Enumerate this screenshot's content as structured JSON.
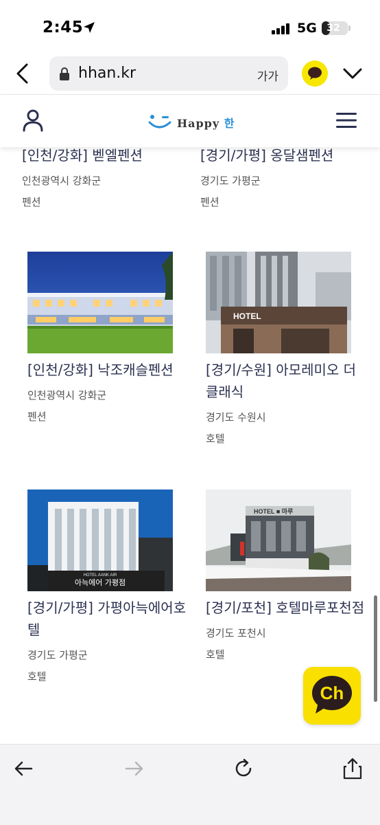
{
  "status_bar": {
    "time": "2:45",
    "network": "5G",
    "battery": "32",
    "battery_level": 0.32
  },
  "browser": {
    "url": "hhan.kr",
    "text_size_label": "가가"
  },
  "site": {
    "logo_text": "Happy",
    "logo_han": "한"
  },
  "listings": [
    {
      "title": "[인천/강화] 벧엘펜션",
      "address": "인천광역시 강화군",
      "type": "펜션"
    },
    {
      "title": "[경기/가평] 옹달샘펜션",
      "address": "경기도 가평군",
      "type": "펜션"
    },
    {
      "title": "[인천/강화] 낙조캐슬펜션",
      "address": "인천광역시 강화군",
      "type": "펜션"
    },
    {
      "title": "[경기/수원] 아모레미오 더 클래식",
      "address": "경기도 수원시",
      "type": "호텔",
      "sign": "HOTEL"
    },
    {
      "title": "[경기/가평] 가평아늑에어호텔",
      "address": "경기도 가평군",
      "type": "호텔",
      "caption_small": "HOTEL AANK AIR",
      "caption": "아늑에어 가평점"
    },
    {
      "title": "[경기/포천] 호텔마루포천점",
      "address": "경기도 포천시",
      "type": "호텔",
      "sign": "HOTEL ■ 마루"
    }
  ],
  "channel_button": {
    "label": "Ch"
  },
  "colors": {
    "accent_yellow": "#f9e000",
    "title_text": "#2b3050",
    "logo_blue": "#2a8fd6"
  }
}
